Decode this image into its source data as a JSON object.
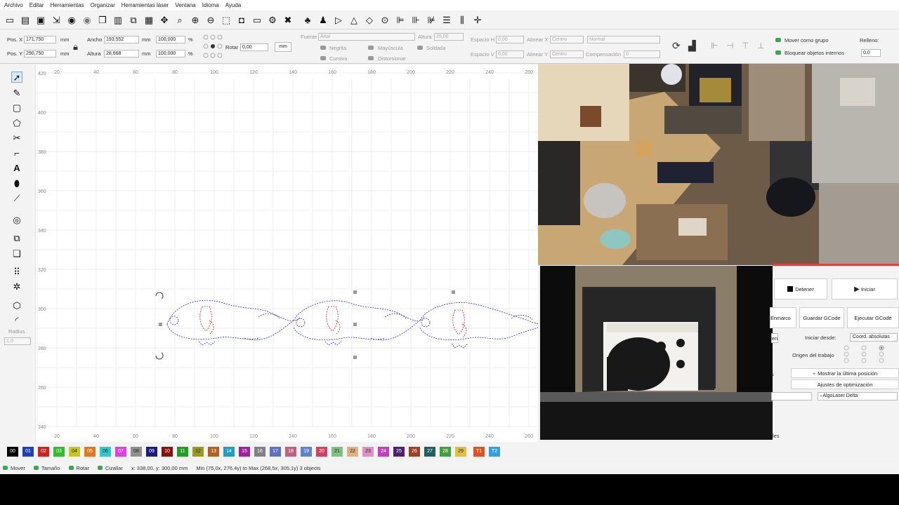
{
  "menu": [
    "Archivo",
    "Editar",
    "Herramientas",
    "Organizar",
    "Herramientas láser",
    "Ventana",
    "Idioma",
    "Ayuda"
  ],
  "toolbar_icons": [
    "open-icon",
    "folder-icon",
    "save-icon",
    "export-icon",
    "undo-icon",
    "redo-icon",
    "copy-icon",
    "paste-icon",
    "duplicate-icon",
    "delete-icon",
    "move-icon",
    "zoom-fit-icon",
    "zoom-in-icon",
    "zoom-out-icon",
    "select-frame-icon",
    "camera-icon",
    "monitor-icon",
    "settings-icon",
    "tools-icon",
    "users-icon",
    "user-icon",
    "arrow-right-icon",
    "warning-icon",
    "target-icon",
    "align-left-icon",
    "align-center-icon",
    "align-bottom-icon",
    "distribute-h-icon",
    "distribute-v-icon",
    "crosshair-icon"
  ],
  "props": {
    "pos_x_label": "Pos. X",
    "pos_x": "171,750",
    "pos_y_label": "Pos. Y",
    "pos_y": "290,750",
    "unit": "mm",
    "ancho_label": "Ancho",
    "ancho": "193,552",
    "altura_label": "Altura",
    "altura": "28,668",
    "scale_w": "100,000",
    "scale_h": "100,000",
    "percent": "%",
    "rotar_label": "Rotar",
    "rotar": "0,00",
    "mm_button": "mm",
    "fuente_label": "Fuente",
    "fuente": "Arial",
    "font_altura_label": "Altura",
    "font_altura": "25,00",
    "negrita": "Negrita",
    "mayuscula": "Mayúscula",
    "soldada": "Soldada",
    "cursiva": "Cursiva",
    "distorsionar": "Distorsionar",
    "espacio_h_label": "Espacio H",
    "espacio_h": "0,00",
    "espacio_v_label": "Espacio V",
    "espacio_v": "0,00",
    "alinear_x_label": "Alinear X",
    "alinear_x": "Centro",
    "alinear_y_label": "Alinear Y",
    "alinear_y": "Centro",
    "normal": "Normal",
    "compensacion_label": "Compensación",
    "compensacion": "0",
    "mover_grupo": "Mover como grupo",
    "bloquear": "Bloquear objetos internos",
    "relleno_label": "Relleno:",
    "relleno": "0,0"
  },
  "left_tools": [
    "select-arrow-icon",
    "pen-icon",
    "rectangle-icon",
    "polygon-icon",
    "bezier-icon",
    "crop-icon",
    "text-icon",
    "location-pin-icon",
    "ruler-icon",
    "offset-icon",
    "boolean-icon",
    "copy-grid-icon",
    "array-icon",
    "gear-sprocket-icon",
    "tab-icon",
    "corner-icon"
  ],
  "radius_label": "Radius",
  "radius_value": "1,0",
  "ruler": {
    "x_ticks": [
      "20",
      "40",
      "60",
      "80",
      "100",
      "120",
      "140",
      "160",
      "180",
      "200",
      "220",
      "240",
      "260"
    ],
    "y_ticks": [
      "420",
      "400",
      "380",
      "360",
      "340",
      "320",
      "300",
      "280",
      "260",
      "240"
    ]
  },
  "laser": {
    "detener": "Detener",
    "iniciar": "Iniciar",
    "enmarcar": "Enmarco",
    "guardar_gcode": "Guardar GCode",
    "ejecutar_gcode": "Ejecutar GCode",
    "iniciar_desde_label": "Iniciar desde:",
    "iniciar_desde": "Coord. absolutas",
    "origen_label": "Origen del trabajo",
    "mostrar_ultima": "Mostrar la última posición",
    "ajustes_opt": "Ajustes de optimización",
    "device": "AlgoLaser Delta",
    "partial_left_1": "en",
    "partial_left_2": "s",
    "tab_partial": "les"
  },
  "palette": [
    {
      "label": "00",
      "color": "#000000"
    },
    {
      "label": "01",
      "color": "#1f3fbf"
    },
    {
      "label": "02",
      "color": "#d42020"
    },
    {
      "label": "03",
      "color": "#2fbf2f"
    },
    {
      "label": "04",
      "color": "#c8c820"
    },
    {
      "label": "05",
      "color": "#e07820"
    },
    {
      "label": "06",
      "color": "#30c8c8"
    },
    {
      "label": "07",
      "color": "#e040e0"
    },
    {
      "label": "08",
      "color": "#909090"
    },
    {
      "label": "09",
      "color": "#1a1a80"
    },
    {
      "label": "10",
      "color": "#8a1010"
    },
    {
      "label": "11",
      "color": "#20a020"
    },
    {
      "label": "12",
      "color": "#9a9a20"
    },
    {
      "label": "13",
      "color": "#b06020"
    },
    {
      "label": "14",
      "color": "#20a0c0"
    },
    {
      "label": "15",
      "color": "#a020a0"
    },
    {
      "label": "16",
      "color": "#808080"
    },
    {
      "label": "17",
      "color": "#6070c0"
    },
    {
      "label": "18",
      "color": "#c06080"
    },
    {
      "label": "19",
      "color": "#6080d0"
    },
    {
      "label": "20",
      "color": "#d04060"
    },
    {
      "label": "21",
      "color": "#80c080"
    },
    {
      "label": "22",
      "color": "#e0b080"
    },
    {
      "label": "23",
      "color": "#e090c0"
    },
    {
      "label": "24",
      "color": "#c040c0"
    },
    {
      "label": "25",
      "color": "#502070"
    },
    {
      "label": "26",
      "color": "#a04020"
    },
    {
      "label": "27",
      "color": "#206060"
    },
    {
      "label": "28",
      "color": "#40a040"
    },
    {
      "label": "29",
      "color": "#e0c040"
    },
    {
      "label": "T1",
      "color": "#e05020"
    },
    {
      "label": "T2",
      "color": "#30a0e0"
    }
  ],
  "status": {
    "mover": "Mover",
    "tamano": "Tamaño",
    "rotar": "Rotar",
    "cizallar": "Cizallar",
    "coords": "x: 338,00, y: 300,00 mm",
    "bounds": "Min (75,0x, 276,4y) to Max (268,5x, 305,1y)  3 objects"
  }
}
